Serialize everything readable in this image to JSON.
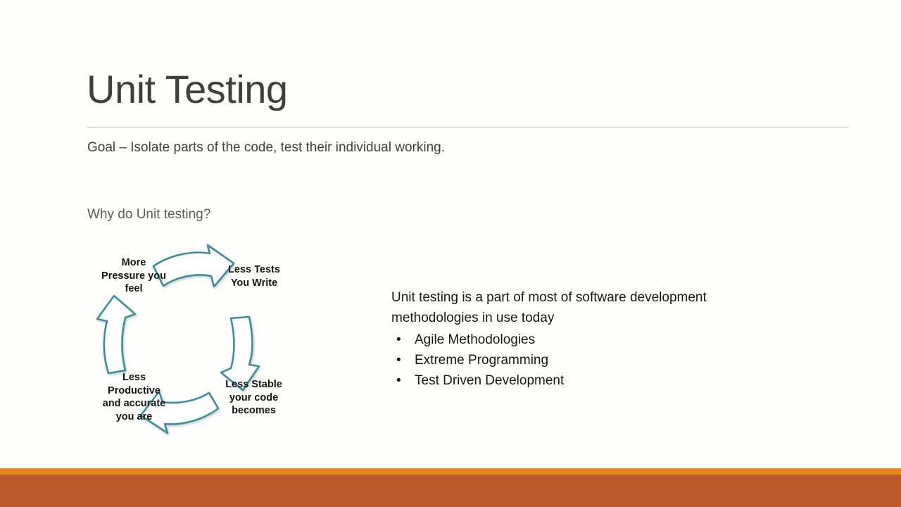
{
  "slide": {
    "title": "Unit Testing",
    "goal_line": "Goal – Isolate parts of the code, test their individual working.",
    "why_line": "Why do Unit testing?"
  },
  "cycle_diagram": {
    "labels": [
      {
        "id": "more-pressure",
        "text": "More\nPressure you\nfeel"
      },
      {
        "id": "less-tests",
        "text": "Less Tests\nYou Write"
      },
      {
        "id": "less-stable",
        "text": "Less Stable\nyour code\nbecomes"
      },
      {
        "id": "less-productive",
        "text": "Less\nProductive\nand accurate\nyou are"
      }
    ],
    "arrows": [
      {
        "id": "arrow-top-right",
        "direction": "right"
      },
      {
        "id": "arrow-right-down",
        "direction": "down"
      },
      {
        "id": "arrow-bottom-left",
        "direction": "left"
      },
      {
        "id": "arrow-left-up",
        "direction": "up"
      }
    ],
    "arrow_color": "#3E8E9C",
    "arrow_fill": "#FFFFFF"
  },
  "right_column": {
    "intro": "Unit testing is a part of most of software development methodologies in use today",
    "bullet_glyph": "•",
    "bullets": [
      "Agile Methodologies",
      "Extreme Programming",
      "Test Driven Development"
    ]
  },
  "theme": {
    "background": "#FEFEFC",
    "title_color": "#3F3F3F",
    "rule_color": "#B8B8B8",
    "body_color": "#161616",
    "muted_color": "#5A5A5A",
    "band_bright": "#E8871E",
    "band_dark": "#BC5A2A"
  }
}
